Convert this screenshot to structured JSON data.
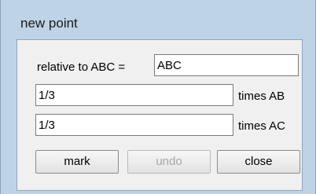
{
  "window": {
    "title": "new point"
  },
  "form": {
    "relative_label": "relative to ABC =",
    "relative_value": "ABC",
    "ab_value": "1/3",
    "ab_label": "times AB",
    "ac_value": "1/3",
    "ac_label": "times AC"
  },
  "buttons": {
    "mark": "mark",
    "undo": "undo",
    "close": "close"
  }
}
